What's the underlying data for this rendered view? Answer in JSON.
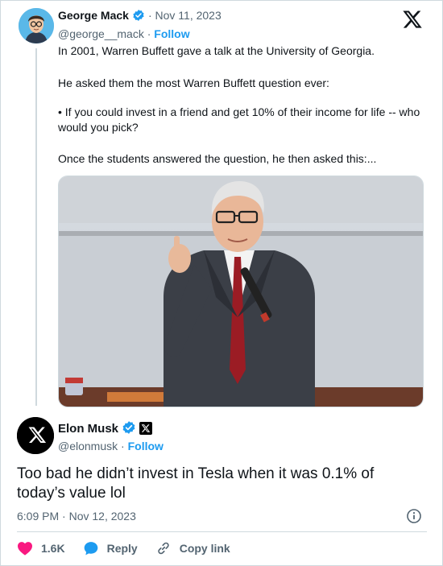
{
  "quoted_tweet": {
    "author_name": "George Mack",
    "date": "Nov 11, 2023",
    "handle": "@george__mack",
    "follow_label": "Follow",
    "paragraphs": [
      "In 2001, Warren Buffett gave a talk at the University of Georgia.",
      "He asked them the most Warren Buffett question ever:",
      "• If you could invest in a friend and get 10% of their income for life -- who would you pick?",
      "Once the students answered the question, he then asked this:..."
    ]
  },
  "main_tweet": {
    "author_name": "Elon Musk",
    "handle": "@elonmusk",
    "follow_label": "Follow",
    "text": "Too bad he didn’t invest in Tesla when it was 0.1% of today’s value lol",
    "timestamp": "6:09 PM · Nov 12, 2023"
  },
  "actions": {
    "likes_count": "1.6K",
    "reply_label": "Reply",
    "copy_link_label": "Copy link"
  },
  "icons": [
    "x-logo-icon",
    "verified-badge-icon",
    "affiliate-x-badge-icon",
    "info-icon",
    "heart-icon",
    "reply-bubble-icon",
    "link-icon"
  ],
  "colors": {
    "accent": "#1d9bf0",
    "like": "#f91880",
    "text": "#0f1419",
    "secondary_text": "#536471",
    "border": "#cfd9de"
  }
}
